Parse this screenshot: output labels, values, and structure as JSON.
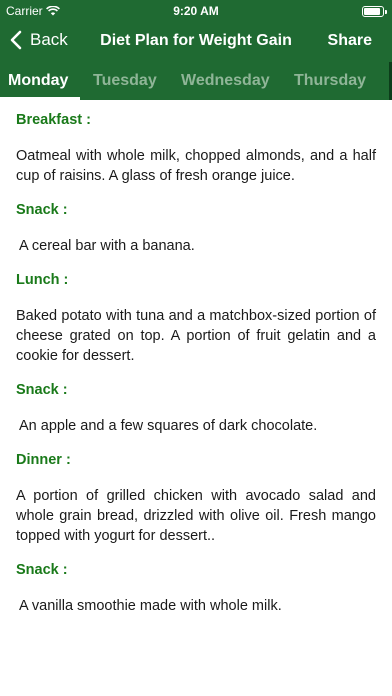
{
  "status": {
    "carrier": "Carrier",
    "time": "9:20 AM"
  },
  "nav": {
    "back_label": "Back",
    "title": "Diet Plan for Weight Gain",
    "share_label": "Share"
  },
  "tabs": [
    {
      "label": "Monday",
      "active": true
    },
    {
      "label": "Tuesday",
      "active": false
    },
    {
      "label": "Wednesday",
      "active": false
    },
    {
      "label": "Thursday",
      "active": false
    }
  ],
  "meals": [
    {
      "heading": "Breakfast  :",
      "text": "Oatmeal with whole milk, chopped almonds, and a half cup of raisins. A glass of fresh orange juice."
    },
    {
      "heading": "Snack  :",
      "text": "A cereal bar with a banana."
    },
    {
      "heading": "Lunch  :",
      "text": "Baked potato with tuna and a matchbox-sized portion of cheese grated on top. A portion of fruit gelatin and a cookie for dessert."
    },
    {
      "heading": "Snack  :",
      "text": "An apple and a few squares of dark chocolate."
    },
    {
      "heading": "Dinner :",
      "text": "A portion of grilled chicken with avocado salad and whole grain bread, drizzled with olive oil. Fresh mango topped with yogurt for dessert.."
    },
    {
      "heading": "Snack :",
      "text": "A vanilla smoothie made with whole milk."
    }
  ],
  "colors": {
    "header": "#1f6a32",
    "heading_green": "#1a7a1a",
    "tab_inactive": "#8fb597"
  }
}
